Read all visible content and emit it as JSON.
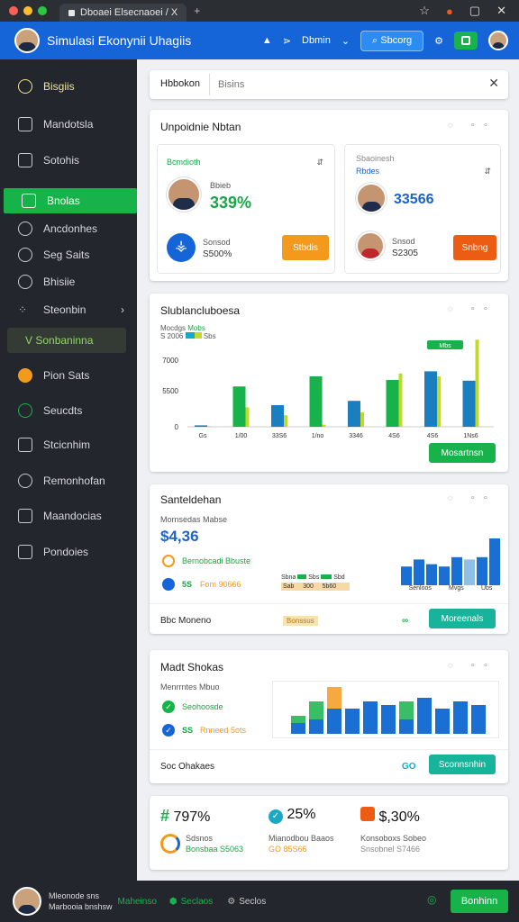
{
  "browser": {
    "tab_title": "Dboaei Elsecnaoei / X",
    "new_tab": "+"
  },
  "app": {
    "title": "Simulasi Ekonynii Uhagiis",
    "nav_label": "Dbmin",
    "search_btn": "Sbcorg"
  },
  "sidebar": {
    "items": [
      "Bisgiis",
      "Mandotsla",
      "Sotohis",
      "Bnolas",
      "Ancdonhes",
      "Seg Saits",
      "Bhisiie",
      "Steonbin",
      "V Sonbaninna",
      "Pion Sats",
      "Seucdts",
      "Stcicnhim",
      "Remonhofan",
      "Maandocias",
      "Pondoies"
    ]
  },
  "topbar": {
    "tab": "Hbbokon",
    "placeholder": "Bisins"
  },
  "card1": {
    "title": "Unpoidnie Nbtan",
    "left": {
      "label": "Bcmdioth",
      "sub": "Bbieb",
      "value": "339%",
      "label2": "Sonsod",
      "value2": "S500%",
      "button": "Stbdis"
    },
    "right": {
      "label": "Sbaoinesh",
      "sub2": "Rbdes",
      "value": "33566",
      "label2": "Snsod",
      "value2": "S2305",
      "button": "Snbng"
    }
  },
  "card2": {
    "title": "Slublancluboesa",
    "legend1": "Mocdgs",
    "legend1b": "Mobs",
    "legend2": "S 2006",
    "legend2b": "Sbs",
    "callout": "Mbs",
    "button": "Mosartnsn",
    "chart_data": {
      "type": "bar",
      "categories": [
        "Gs",
        "1/00",
        "33S6",
        "1/no",
        "3346",
        "4S6",
        "4S6",
        "1Ns6"
      ],
      "yticks": [
        "7000",
        "5500",
        "0"
      ],
      "series": [
        {
          "values": [
            200,
            5600,
            3000,
            7000,
            3600,
            6500,
            7700,
            6400
          ]
        },
        {
          "values": [
            80,
            2700,
            1600,
            300,
            2000,
            7400,
            7000,
            12100
          ]
        }
      ],
      "ylim": [
        0,
        12500
      ]
    }
  },
  "card3": {
    "title": "Santeldehan",
    "sub": "Mornsedas Mabse",
    "value": "$4,36",
    "row1": "Bernobcadi Bbuste",
    "row2a": "5S",
    "row2b": "Fom 90666",
    "mini_labels": [
      "Sbna",
      "Sbs",
      "Sbd"
    ],
    "mini_bars": [
      "Sab",
      "300",
      "5b60"
    ],
    "bars_labels": [
      "Senloos",
      "Mvgs",
      "Ubs"
    ],
    "bars": [
      40,
      55,
      45,
      40,
      60,
      55,
      60,
      100
    ],
    "footer": "Bbc Moneno",
    "footer_mid": "Bonssus",
    "button": "Moreenals"
  },
  "card4": {
    "title": "Madt Shokas",
    "sub": "Menrrntes Mbuo",
    "row1": "Seohoosde",
    "row2a": "SS",
    "row2b": "Rnneed 5ots",
    "footer": "Soc Ohakaes",
    "footer_mid": "GO",
    "button": "Sconnsnhin",
    "bars": [
      {
        "a": 15,
        "b": 10
      },
      {
        "a": 20,
        "b": 25
      },
      {
        "a": 35,
        "b": 30
      },
      {
        "a": 35,
        "b": 0
      },
      {
        "a": 45,
        "b": 0
      },
      {
        "a": 40,
        "b": 0
      },
      {
        "a": 20,
        "b": 25
      },
      {
        "a": 50,
        "b": 0
      },
      {
        "a": 35,
        "b": 0
      },
      {
        "a": 45,
        "b": 0
      },
      {
        "a": 40,
        "b": 0
      }
    ]
  },
  "stats": [
    {
      "value": "797%",
      "label": "Sdsnos",
      "sub": "Bonsbaa S5063"
    },
    {
      "value": "25%",
      "label": "Mianodbou Baaos",
      "sub": "GO 85S66"
    },
    {
      "value": "$,30%",
      "label": "Konsoboxs Sobeo",
      "sub": "Snsobnel S7466"
    }
  ],
  "bottom": {
    "line1": "Mleonode sns",
    "line2": "Marbooia bnshsw",
    "item1": "Maheinso",
    "item2": "Seclaos",
    "item3": "Seclos",
    "button": "Bonhinn"
  },
  "colors": {
    "green": "#17b34a",
    "blue": "#1565d8",
    "orange": "#f39a1c"
  }
}
